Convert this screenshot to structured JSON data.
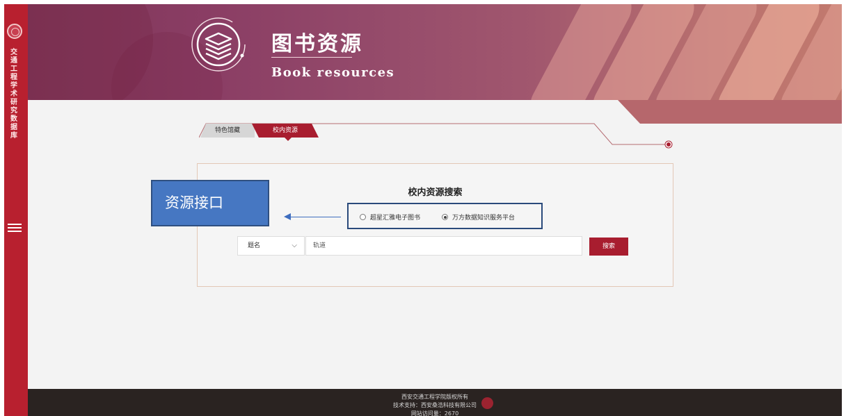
{
  "sidebar": {
    "vertical_title": "交通工程学术研究数据库",
    "menu_icon": "hamburger-menu-icon"
  },
  "banner": {
    "title": "图书资源",
    "subtitle": "Book resources",
    "icon": "book-stack-icon"
  },
  "tabs": [
    {
      "label": "特色馆藏",
      "active": false
    },
    {
      "label": "校内资源",
      "active": true
    }
  ],
  "search_panel": {
    "title": "校内资源搜索",
    "sources": [
      {
        "label": "超星汇雅电子图书",
        "selected": false
      },
      {
        "label": "万方数据知识服务平台",
        "selected": true
      }
    ],
    "field_select": "题名",
    "query": "轨道",
    "button_label": "搜索"
  },
  "annotation": {
    "label": "资源接口"
  },
  "footer": {
    "copyright": "西安交通工程学院版权所有",
    "support": "技术支持：西安桑浩科技有限公司",
    "visits": "网站访问量：2670"
  },
  "colors": {
    "accent": "#a81d2f",
    "sidebar": "#b8202f",
    "annotation": "#4677c2"
  }
}
